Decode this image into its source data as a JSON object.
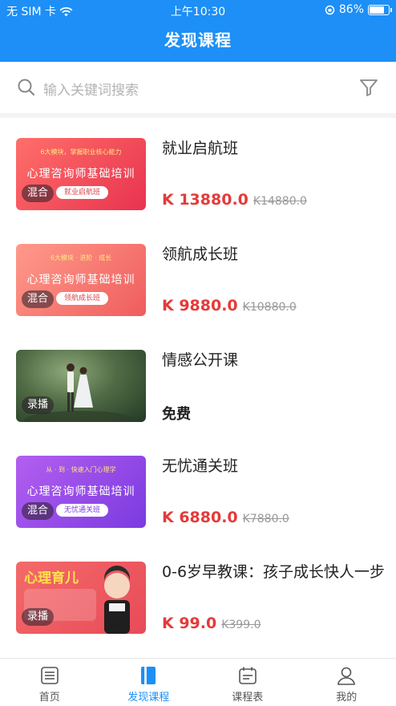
{
  "status_bar": {
    "carrier": "无 SIM 卡",
    "time": "上午10:30",
    "battery": "86%",
    "battery_level": 0.86
  },
  "header": {
    "title": "发现课程"
  },
  "search": {
    "placeholder": "输入关键词搜索"
  },
  "colors": {
    "brand": "#1d8ff6",
    "price": "#e53a3a"
  },
  "courses": [
    {
      "name": "就业启航班",
      "price": "K 13880.0",
      "original_price": "K14880.0",
      "thumb": {
        "top_text": "6大模块，掌握职业核心能力",
        "banner": "心理咨询师基础培训",
        "tag": "混合",
        "pill": "就业启航班",
        "style": "red"
      }
    },
    {
      "name": "领航成长班",
      "price": "K 9880.0",
      "original_price": "K10880.0",
      "thumb": {
        "top_text": "6大模块 · 进阶 · 成长",
        "banner": "心理咨询师基础培训",
        "tag": "混合",
        "pill": "领航成长班",
        "style": "salmon"
      }
    },
    {
      "name": "情感公开课",
      "free_label": "免费",
      "thumb": {
        "tag": "录播",
        "style": "photo"
      }
    },
    {
      "name": "无忧通关班",
      "price": "K 6880.0",
      "original_price": "K7880.0",
      "thumb": {
        "top_text": "从 · 到 · 快速入门心理学",
        "banner": "心理咨询师基础培训",
        "tag": "混合",
        "pill": "无忧通关班",
        "style": "purple"
      }
    },
    {
      "name": "0-6岁早教课：孩子成长快人一步",
      "price": "K 99.0",
      "original_price": "K399.0",
      "thumb": {
        "top_text": "心理育儿",
        "tag": "录播",
        "style": "kid"
      }
    }
  ],
  "tabbar": {
    "items": [
      {
        "label": "首页",
        "icon": "list-icon"
      },
      {
        "label": "发现课程",
        "icon": "book-icon",
        "active": true
      },
      {
        "label": "课程表",
        "icon": "schedule-icon"
      },
      {
        "label": "我的",
        "icon": "person-icon"
      }
    ]
  }
}
